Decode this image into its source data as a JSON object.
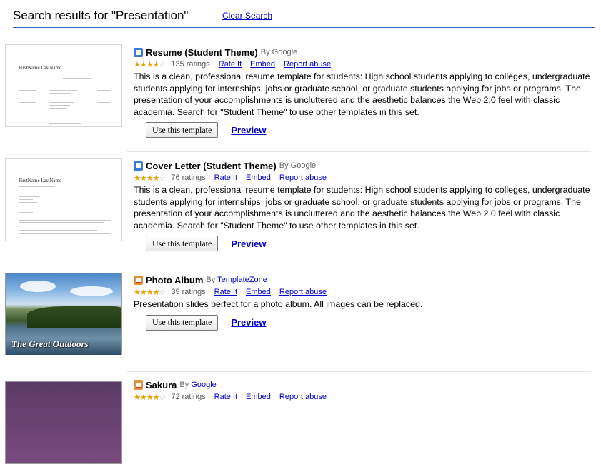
{
  "header": {
    "title": "Search results for \"Presentation\"",
    "clear_label": "Clear Search"
  },
  "actions": {
    "rate_label": "Rate It",
    "embed_label": "Embed",
    "report_label": "Report abuse",
    "use_label": "Use this template",
    "preview_label": "Preview",
    "by_prefix": "By"
  },
  "results": [
    {
      "name": "Resume (Student Theme)",
      "author": "Google",
      "ratings": "135 ratings",
      "stars": 4,
      "type_icon": "document-icon",
      "thumb_name": "FirstName LastName",
      "description": "This is a clean, professional resume template for students: High school students applying to colleges, undergraduate students applying for internships, jobs or graduate school, or graduate students applying for jobs or programs. The presentation of your accomplishments is uncluttered and the aesthetic balances the Web 2.0 feel with classic academia. Search for \"Student Theme\" to use other templates in this set."
    },
    {
      "name": "Cover Letter (Student Theme)",
      "author": "Google",
      "ratings": "76 ratings",
      "stars": 4,
      "type_icon": "document-icon",
      "thumb_name": "FirstName LastName",
      "description": "This is a clean, professional resume template for students: High school students applying to colleges, undergraduate students applying for internships, jobs or graduate school, or graduate students applying for jobs or programs. The presentation of your accomplishments is uncluttered and the aesthetic balances the Web 2.0 feel with classic academia. Search for \"Student Theme\" to use other templates in this set."
    },
    {
      "name": "Photo Album",
      "author": "TemplateZone",
      "ratings": "39 ratings",
      "stars": 4,
      "type_icon": "presentation-icon",
      "thumb_caption": "The Great Outdoors",
      "description": "Presentation slides perfect for a photo album. All images can be replaced."
    },
    {
      "name": "Sakura",
      "author": "Google",
      "ratings": "72 ratings",
      "stars": 4,
      "type_icon": "presentation-icon"
    }
  ]
}
